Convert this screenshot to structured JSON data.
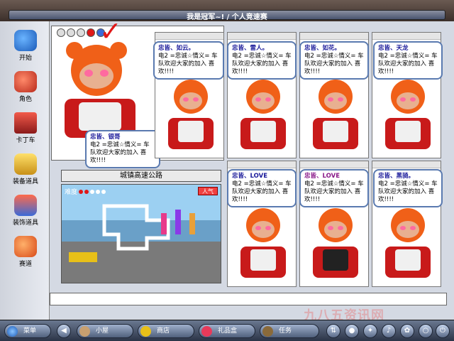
{
  "window": {
    "title": "我是冠军~! / 个人竞速赛"
  },
  "sidebar": {
    "items": [
      {
        "label": "开始",
        "icon": "play-icon",
        "color": "#2a7ad8"
      },
      {
        "label": "角色",
        "icon": "character-icon",
        "color": "#d83a2a"
      },
      {
        "label": "卡丁车",
        "icon": "kart-icon",
        "color": "#c82a2a"
      },
      {
        "label": "装备道具",
        "icon": "goggles-icon",
        "color": "#e8b818"
      },
      {
        "label": "装饰道具",
        "icon": "decoration-icon",
        "color": "#3a7ad8"
      },
      {
        "label": "赛道",
        "icon": "track-icon",
        "color": "#e85a18"
      }
    ]
  },
  "host": {
    "name": "忠皆、银哥",
    "message": "电2 =忠诚☆情义= 车队欢迎大家的加入 喜欢!!!!"
  },
  "players": [
    {
      "name": "忠皆、如云。",
      "message": "电2 =忠诚☆情义= 车队欢迎大家的加入 喜欢!!!!",
      "pink": false
    },
    {
      "name": "忠皆、雷人。",
      "message": "电2 =忠诚☆情义= 车队欢迎大家的加入 喜欢!!!!",
      "pink": false
    },
    {
      "name": "忠皆、如花。",
      "message": "电2 =忠诚☆情义= 车队欢迎大家的加入 喜欢!!!!",
      "pink": false
    },
    {
      "name": "忠皆、天龙",
      "message": "电2 =忠诚☆情义= 车队欢迎大家的加入 喜欢!!!!",
      "pink": false
    },
    {
      "name": "忠皆、LOVE",
      "message": "电2 =忠诚☆情义= 车队欢迎大家的加入 喜欢!!!!",
      "pink": false
    },
    {
      "name": "忠皆、LOVE",
      "message": "电2 =忠诚☆情义= 车队欢迎大家的加入 喜欢!!!!",
      "pink": true
    },
    {
      "name": "忠皆、黑骑。",
      "message": "电2 =忠诚☆情义= 车队欢迎大家的加入 喜欢!!!!",
      "pink": false
    }
  ],
  "track": {
    "name": "城镇高速公路",
    "difficulty_label": "难度",
    "difficulty": 2,
    "difficulty_max": 5,
    "people_label": "人气"
  },
  "chat": {
    "input": ""
  },
  "taskbar": {
    "menu": "菜单",
    "buttons": [
      {
        "label": "小屋",
        "icon": "house-icon"
      },
      {
        "label": "商店",
        "icon": "shop-icon"
      },
      {
        "label": "礼品盒",
        "icon": "gift-icon"
      },
      {
        "label": "任务",
        "icon": "book-icon"
      }
    ]
  },
  "watermark": "九八五资讯网",
  "colors": {
    "accent": "#e01818",
    "bubble_border": "#5a7ab0",
    "name_blue": "#1a1a9a",
    "name_purple": "#8a1a8a"
  }
}
